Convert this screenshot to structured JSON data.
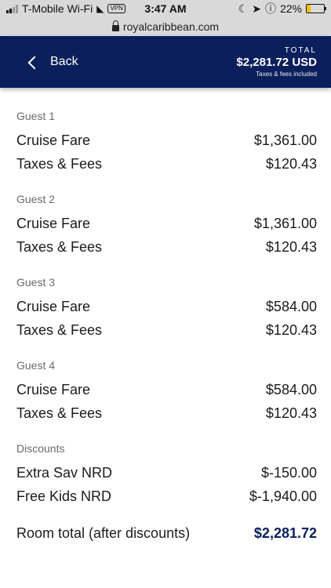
{
  "status_bar": {
    "carrier": "T-Mobile Wi-Fi",
    "vpn": "VPN",
    "time": "3:47 AM",
    "battery": "22%",
    "battery_level": 0.22
  },
  "browser": {
    "url": "royalcaribbean.com"
  },
  "header": {
    "back_label": "Back",
    "total_label": "TOTAL",
    "total_amount": "$2,281.72 USD",
    "total_note": "Taxes & fees included"
  },
  "sections": [
    {
      "label": "Guest 1",
      "rows": [
        {
          "name": "Cruise Fare",
          "amount": "$1,361.00"
        },
        {
          "name": "Taxes & Fees",
          "amount": "$120.43"
        }
      ]
    },
    {
      "label": "Guest 2",
      "rows": [
        {
          "name": "Cruise Fare",
          "amount": "$1,361.00"
        },
        {
          "name": "Taxes & Fees",
          "amount": "$120.43"
        }
      ]
    },
    {
      "label": "Guest 3",
      "rows": [
        {
          "name": "Cruise Fare",
          "amount": "$584.00"
        },
        {
          "name": "Taxes & Fees",
          "amount": "$120.43"
        }
      ]
    },
    {
      "label": "Guest 4",
      "rows": [
        {
          "name": "Cruise Fare",
          "amount": "$584.00"
        },
        {
          "name": "Taxes & Fees",
          "amount": "$120.43"
        }
      ]
    },
    {
      "label": "Discounts",
      "rows": [
        {
          "name": "Extra Sav NRD",
          "amount": "$-150.00"
        },
        {
          "name": "Free Kids NRD",
          "amount": "$-1,940.00"
        }
      ]
    }
  ],
  "room_total": {
    "label": "Room total (after discounts)",
    "amount": "$2,281.72"
  },
  "colors": {
    "brand_navy": "#0b1f5c",
    "status_bar": "#d9d9d9"
  }
}
